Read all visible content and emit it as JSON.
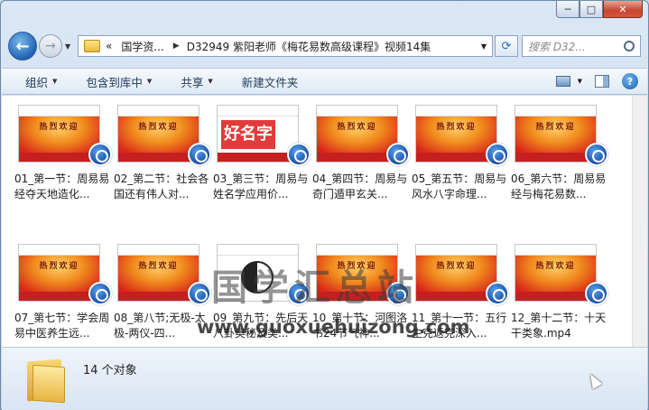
{
  "window": {
    "minimize": "─",
    "maximize": "□",
    "close": "✕"
  },
  "nav": {
    "back": "←",
    "forward": "→",
    "address": {
      "root": "«",
      "crumbs": [
        "国学资...",
        "D32949  紫阳老师《梅花易数高级课程》视频14集"
      ]
    },
    "search_placeholder": "搜索 D32..."
  },
  "toolbar": {
    "organize": "组织",
    "include": "包含到库中",
    "share": "共享",
    "new_folder": "新建文件夹"
  },
  "files": [
    {
      "name": "01_第一节：周易易经夺天地造化...",
      "thumb": "red",
      "slide": "热烈欢迎"
    },
    {
      "name": "02_第二节：社会各国还有伟人对...",
      "thumb": "red",
      "slide": "热烈欢迎"
    },
    {
      "name": "03_第三节：周易与姓名学应用价...",
      "thumb": "white",
      "slide": "好名字"
    },
    {
      "name": "04_第四节：周易与奇门遁甲玄关...",
      "thumb": "red",
      "slide": "热烈欢迎"
    },
    {
      "name": "05_第五节：周易与风水八字命理...",
      "thumb": "red",
      "slide": "热烈欢迎"
    },
    {
      "name": "06_第六节：周易易经与梅花易数...",
      "thumb": "red",
      "slide": "热烈欢迎"
    },
    {
      "name": "07_第七节：学会周易中医养生远...",
      "thumb": "red",
      "slide": "热烈欢迎"
    },
    {
      "name": "08_第八节;无极-太极-两仪-四...",
      "thumb": "red",
      "slide": "热烈欢迎"
    },
    {
      "name": "09_第九节：先后天八卦奥秘及类...",
      "thumb": "taiji",
      "slide": ""
    },
    {
      "name": "10_第十节：河图洛书24节气神...",
      "thumb": "red",
      "slide": "热烈欢迎"
    },
    {
      "name": "11_第十一节：五行生克返克深入...",
      "thumb": "red",
      "slide": "热烈欢迎"
    },
    {
      "name": "12_第十二节：十天干类象.mp4",
      "thumb": "red",
      "slide": "热烈欢迎"
    }
  ],
  "watermark": {
    "text": "国学汇总站",
    "url": "www.guoxuehuizong.com"
  },
  "status": {
    "count": "14 个对象"
  }
}
